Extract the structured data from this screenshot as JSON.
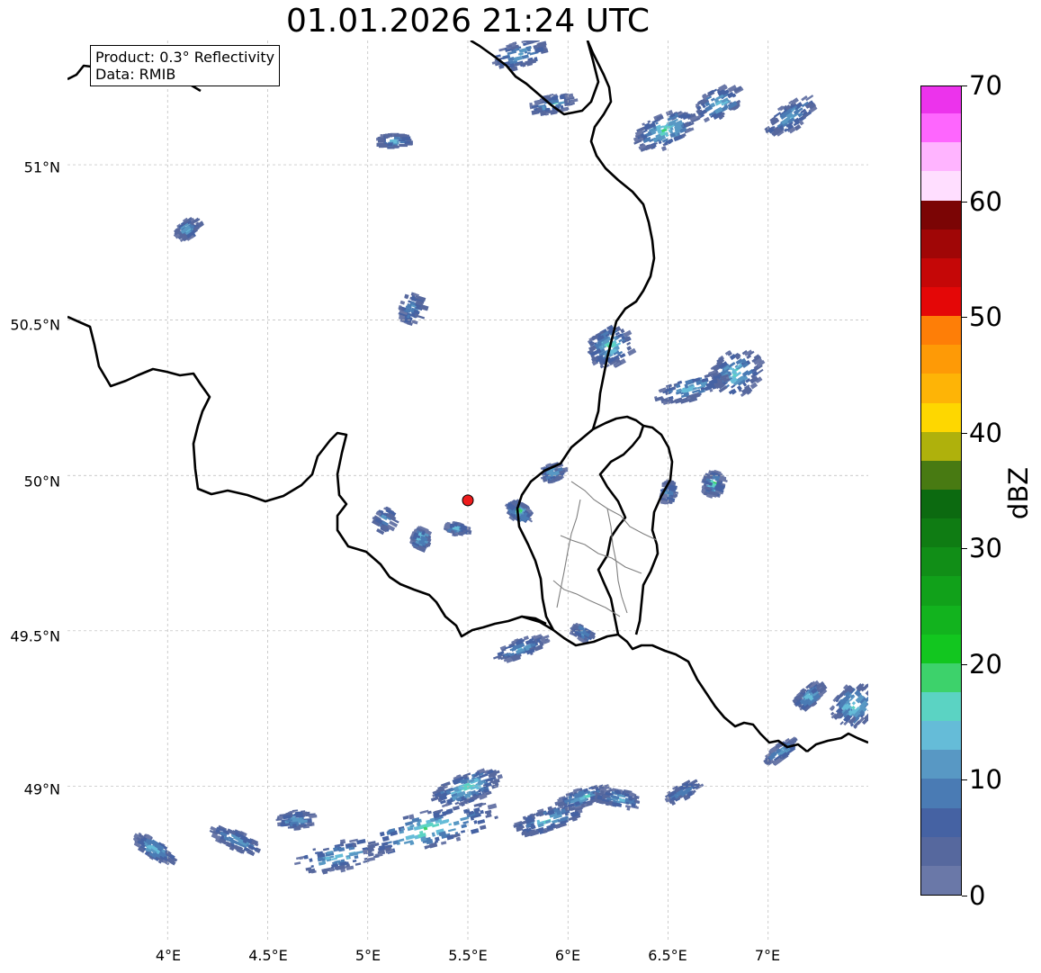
{
  "title": "01.01.2026 21:24 UTC",
  "info": {
    "product": "Product: 0.3° Reflectivity",
    "source": "Data: RMIB"
  },
  "x_ticks": [
    "4°E",
    "4.5°E",
    "5°E",
    "5.5°E",
    "6°E",
    "6.5°E",
    "7°E"
  ],
  "y_ticks": [
    "51°N",
    "50.5°N",
    "50°N",
    "49.5°N",
    "49°N"
  ],
  "colorbar": {
    "label": "dBZ",
    "ticks": [
      "0",
      "10",
      "20",
      "30",
      "40",
      "50",
      "60",
      "70"
    ],
    "range": [
      0,
      70
    ],
    "step": 2.5,
    "colors": [
      "#6a78a8",
      "#56689e",
      "#4562a3",
      "#4a7bb4",
      "#5898c4",
      "#65bcd8",
      "#5bd3c3",
      "#3dd26b",
      "#12c61f",
      "#12b31e",
      "#11a11a",
      "#118e17",
      "#0f7c13",
      "#0c6a10",
      "#487a12",
      "#afb10c",
      "#fed700",
      "#feb406",
      "#fe9a06",
      "#fe7e07",
      "#e40707",
      "#c50707",
      "#a00606",
      "#7b0505",
      "#ffdeff",
      "#ffb4ff",
      "#fe66fe",
      "#ec33ec"
    ]
  },
  "map": {
    "lon_range": [
      3.5,
      7.5
    ],
    "lat_range": [
      48.5,
      51.4
    ],
    "marker": {
      "lon": 5.5,
      "lat": 49.92,
      "color": "#ee1c1c"
    }
  }
}
